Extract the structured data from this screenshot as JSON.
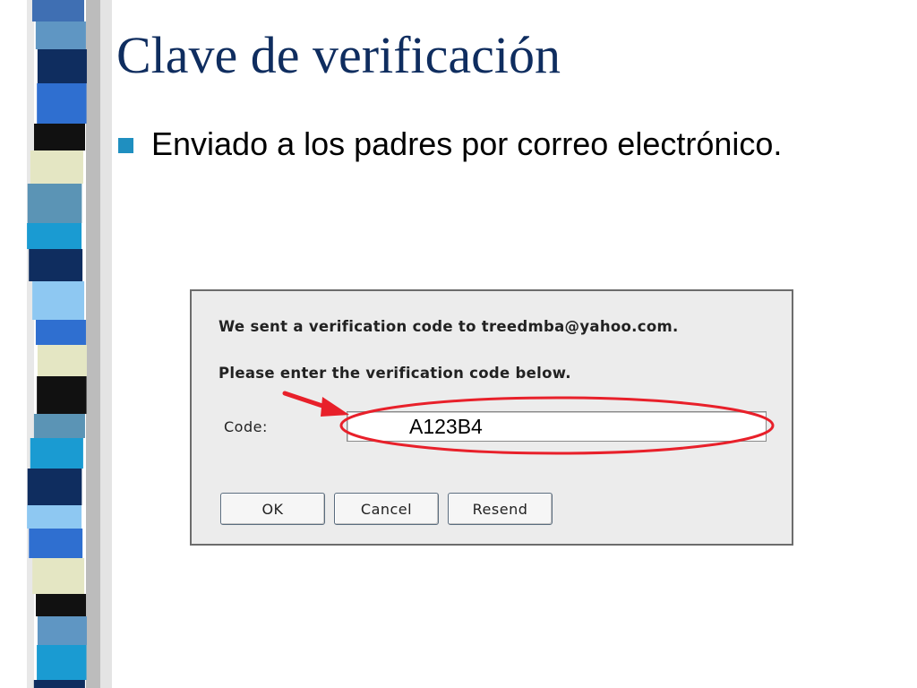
{
  "slide": {
    "title": "Clave de verificación",
    "bullet": "Enviado a los padres por correo electrónico."
  },
  "dialog": {
    "line1": "We sent a verification code to treedmba@yahoo.com.",
    "line2": "Please enter the verification code below.",
    "code_label": "Code:",
    "code_value": "A123B4",
    "buttons": {
      "ok": "OK",
      "cancel": "Cancel",
      "resend": "Resend"
    }
  },
  "colors": {
    "title": "#0f2d5f",
    "bullet": "#1f8fc0",
    "highlight": "#e8202a",
    "dialog_bg": "#ececec"
  },
  "icons": {
    "arrow": "red-arrow-icon",
    "bullet": "square-bullet-icon"
  }
}
